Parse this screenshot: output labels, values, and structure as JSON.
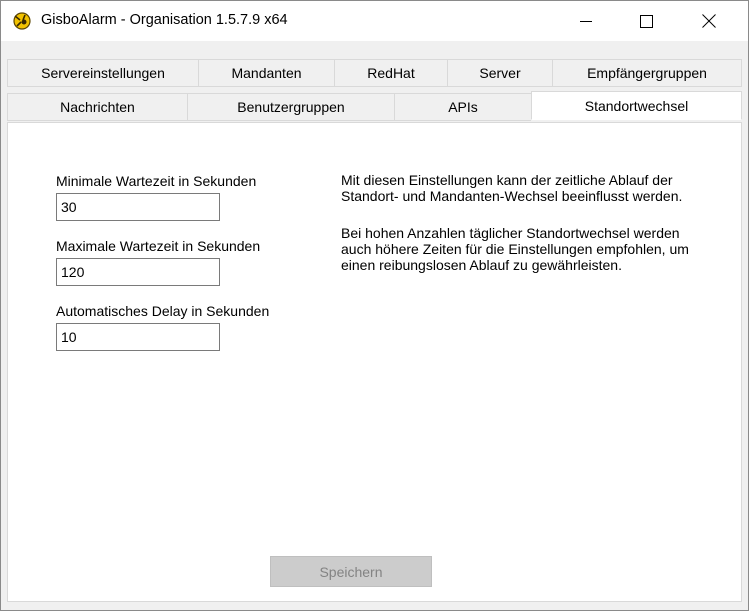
{
  "window": {
    "title": "GisboAlarm - Organisation 1.5.7.9 x64",
    "icon": "gisboalarm-app-icon",
    "controls": [
      "minimize-icon",
      "maximize-icon",
      "close-icon"
    ]
  },
  "tabs": {
    "row1": [
      {
        "label": "Servereinstellungen"
      },
      {
        "label": "Mandanten"
      },
      {
        "label": "RedHat"
      },
      {
        "label": "Server"
      },
      {
        "label": "Empfängergruppen"
      }
    ],
    "row2": [
      {
        "label": "Nachrichten"
      },
      {
        "label": "Benutzergruppen"
      },
      {
        "label": "APIs"
      },
      {
        "label": "Standortwechsel",
        "active": true
      }
    ]
  },
  "form": {
    "min_wait": {
      "label": "Minimale Wartezeit in Sekunden",
      "value": "30"
    },
    "max_wait": {
      "label": "Maximale Wartezeit in Sekunden",
      "value": "120"
    },
    "auto_delay": {
      "label": "Automatisches Delay in Sekunden",
      "value": "10"
    }
  },
  "info": {
    "para1_line1": "Mit diesen Einstellungen kann der zeitliche Ablauf der",
    "para1_line2": "Standort- und Mandanten-Wechsel beeinflusst werden.",
    "para2_line1": "Bei hohen Anzahlen täglicher Standortwechsel werden",
    "para2_line2": "auch höhere Zeiten für die Einstellungen empfohlen, um",
    "para2_line3": "einen reibungslosen Ablauf zu gewährleisten."
  },
  "save_button": {
    "label": "Speichern",
    "enabled": false
  },
  "colors": {
    "window_bg": "#f0f0f0",
    "panel_bg": "#ffffff",
    "disabled_button_bg": "#cccccc",
    "disabled_text": "#838383"
  }
}
